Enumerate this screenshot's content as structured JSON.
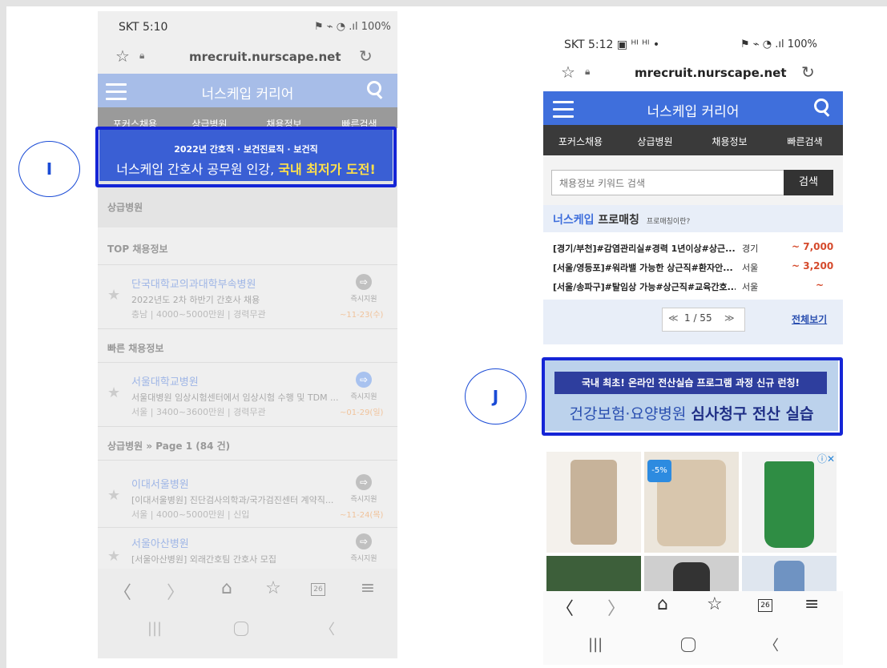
{
  "left": {
    "status": {
      "carrier": "SKT 5:10",
      "signal_icons": "ᴴᴵ ᴴᴵ ⬚ •",
      "battery": "100%"
    },
    "url": "mrecruit.nurscape.net",
    "header": {
      "title": "너스케입 커리어"
    },
    "tabs": [
      "포커스채용",
      "상급병원",
      "채용정보",
      "빠른검색"
    ],
    "banner": {
      "top": "2022년 간호직 · 보건진료직 · 보건직",
      "main_prefix": "너스케입 간호사 공무원 인강, ",
      "main_highlight": "국내 최저가 도전!"
    },
    "section1": "상급병원",
    "section2": "TOP 채용정보",
    "section3": "빠른 채용정보",
    "section4": "상급병원 » Page 1 (84 건)",
    "jobs": [
      {
        "name": "단국대학교의과대학부속병원",
        "desc": "2022년도 2차 하반기 간호사 채용",
        "meta": "충남 | 4000~5000만원 | 경력무관",
        "badge": "즉시지원",
        "date": "~11-23(수)"
      },
      {
        "name": "서울대학교병원",
        "desc": "서울대병원 임상시험센터에서 임상시험 수행 및 TDM ...",
        "meta": "서울 | 3400~3600만원 | 경력무관",
        "badge": "즉시지원",
        "date": "~01-29(일)"
      },
      {
        "name": "이대서울병원",
        "desc": "[이대서울병원] 진단검사의학과/국가검진센터 계약직...",
        "meta": "서울 | 4000~5000만원 | 신입",
        "badge": "즉시지원",
        "date": "~11-24(목)"
      },
      {
        "name": "서울아산병원",
        "desc": "[서울아산병원] 외래간호팀 간호사 모집",
        "meta": "",
        "badge": "즉시지원",
        "date": ""
      }
    ],
    "tab_count": "26",
    "circle_label": "I"
  },
  "right": {
    "status": {
      "carrier": "SKT 5:12",
      "signal_icons": "ᴴᴵ ᴴᴵ •",
      "battery": "100%"
    },
    "url": "mrecruit.nurscape.net",
    "header": {
      "title": "너스케입 커리어"
    },
    "tabs": [
      "포커스채용",
      "상급병원",
      "채용정보",
      "빠른검색"
    ],
    "search": {
      "placeholder": "채용정보 키워드 검색",
      "button": "검색"
    },
    "pro": {
      "brand": "너스케입",
      "title": "프로매칭",
      "sub": "프로매칭이란?"
    },
    "matches": [
      {
        "text": "[경기/부천]#감염관리실#경력 1년이상#상근...",
        "loc": "경기",
        "salary": "~ 7,000"
      },
      {
        "text": "[서울/영등포]#워라밸 가능한 상근직#환자안...",
        "loc": "서울",
        "salary": "~ 3,200"
      },
      {
        "text": "[서울/송파구]#탈임상 가능#상근직#교육간호...",
        "loc": "서울",
        "salary": "~"
      }
    ],
    "pager": {
      "prev": "≪",
      "page": "1 / 55",
      "next": "≫",
      "view_all": "전체보기"
    },
    "banner": {
      "line1": "국내 최초! 온라인 전산실습 프로그램 과정 신규 런칭!",
      "line2_prefix": "건강보험·요양병원 ",
      "line2_bold": "심사청구 전산 실습"
    },
    "ad": {
      "discount": "-5%"
    },
    "tab_count": "26",
    "circle_label": "J"
  },
  "colors": {
    "header_blue": "#3f6fdc",
    "nav_dark": "#3a3a3a",
    "banner_border": "#1525d6"
  }
}
